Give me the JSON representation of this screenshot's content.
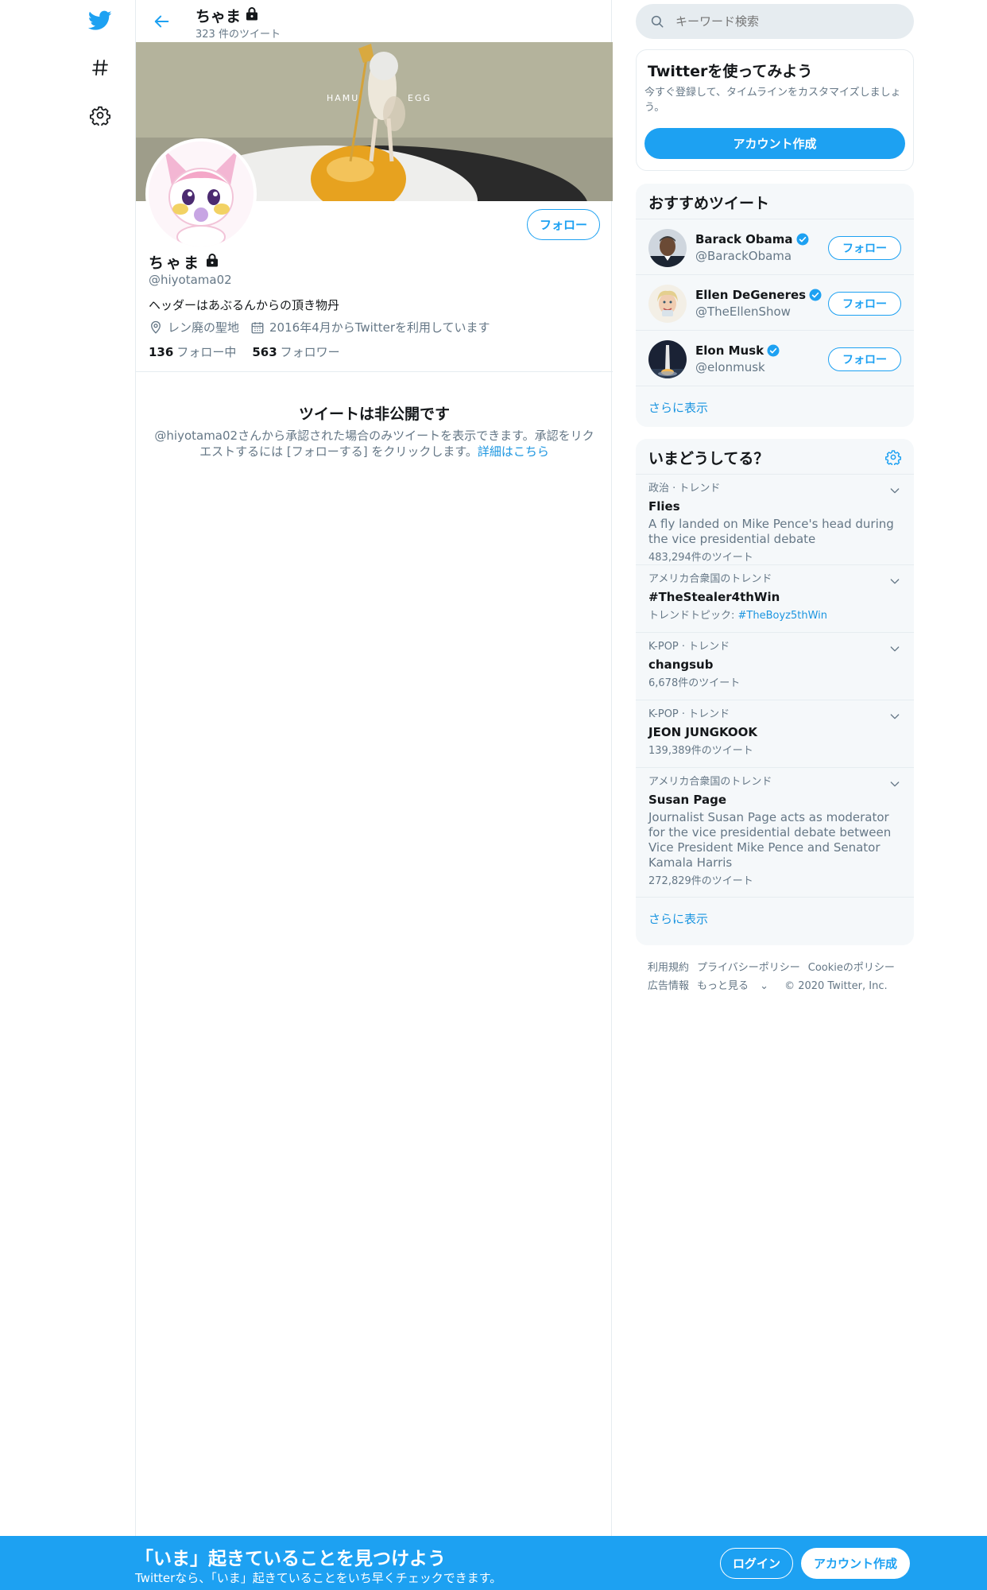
{
  "nav": {
    "icons": [
      "twitter-logo-icon",
      "hashtag-icon",
      "settings-icon"
    ]
  },
  "header": {
    "name": "ちゃま",
    "tweet_count": "323 件のツイート"
  },
  "banner": {
    "text_left": "HAMU",
    "text_right": "EGG"
  },
  "profile": {
    "name": "ちゃま",
    "handle": "@hiyotama02",
    "bio": "ヘッダーはあぶるんからの頂き物丹",
    "location": "レン廃の聖地",
    "joined": "2016年4月からTwitterを利用しています",
    "following_count": "136",
    "following_label": "フォロー中",
    "followers_count": "563",
    "followers_label": "フォロワー",
    "follow_label": "フォロー"
  },
  "protected": {
    "title": "ツイートは非公開です",
    "desc": "@hiyotama02さんから承認された場合のみツイートを表示できます。承認をリクエストするには [フォローする] をクリックします。",
    "link": "詳細はこちら"
  },
  "search": {
    "placeholder": "キーワード検索"
  },
  "signup_card": {
    "title": "Twitterを使ってみよう",
    "desc": "今すぐ登録して、タイムラインをカスタマイズしましょう。",
    "button": "アカウント作成"
  },
  "recommended": {
    "title": "おすすめツイート",
    "follow_label": "フォロー",
    "users": [
      {
        "name": "Barack Obama",
        "handle": "@BarackObama"
      },
      {
        "name": "Ellen DeGeneres",
        "handle": "@TheEllenShow"
      },
      {
        "name": "Elon Musk",
        "handle": "@elonmusk"
      }
    ],
    "more": "さらに表示"
  },
  "trends": {
    "title": "いまどうしてる？",
    "items": [
      {
        "category": "政治 · トレンド",
        "title": "Flies",
        "desc": "A fly landed on Mike Pence's head during the vice presidential debate",
        "count": "483,294件のツイート"
      },
      {
        "category": "アメリカ合衆国のトレンド",
        "title": "#TheStealer4thWin",
        "count_prefix": "トレンドトピック: ",
        "count_link": "#TheBoyz5thWin"
      },
      {
        "category": "K-POP · トレンド",
        "title": "changsub",
        "count": "6,678件のツイート"
      },
      {
        "category": "K-POP · トレンド",
        "title": "JEON JUNGKOOK",
        "count": "139,389件のツイート"
      },
      {
        "category": "アメリカ合衆国のトレンド",
        "title": "Susan Page",
        "desc": "Journalist Susan Page acts as moderator for the vice presidential debate between Vice President Mike Pence and Senator Kamala Harris",
        "count": "272,829件のツイート"
      }
    ],
    "more": "さらに表示"
  },
  "footer": {
    "terms": "利用規約",
    "privacy": "プライバシーポリシー",
    "cookie": "Cookieのポリシー",
    "ads": "広告情報",
    "more": "もっと見る",
    "copyright": "© 2020 Twitter, Inc."
  },
  "bottombar": {
    "title": "「いま」起きていることを見つけよう",
    "subtitle": "Twitterなら、「いま」起きていることをいち早くチェックできます。",
    "login": "ログイン",
    "signup": "アカウント作成"
  },
  "colors": {
    "accent": "#1da1f2",
    "secondary_text": "#657786",
    "card_bg": "#f5f8fa",
    "link": "#1b95e0"
  }
}
